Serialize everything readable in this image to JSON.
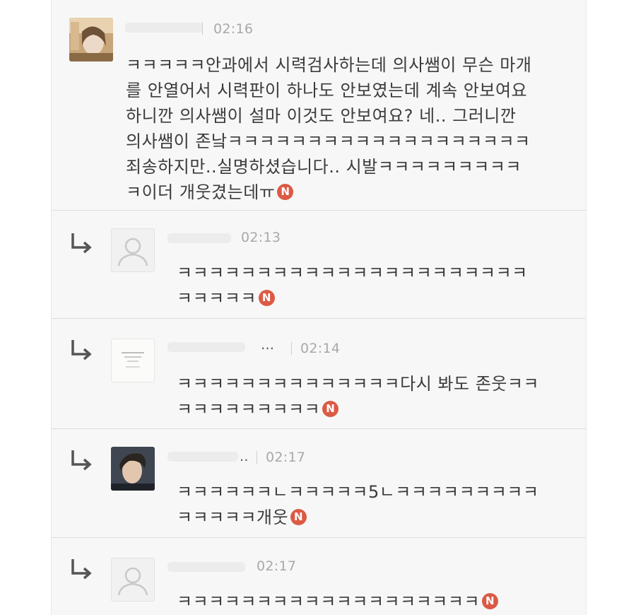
{
  "post": {
    "time": "02:16",
    "lines": [
      "ㅋㅋㅋㅋㅋ안과에서 시력검사하는데 의사쌤이 무슨 마개",
      "를 안열어서 시력판이 하나도 안보였는데 계속 안보여요",
      "하니깐 의사쌤이 설마 이것도 안보여요? 네.. 그러니깐",
      "의사쌤이 존낰ㅋㅋㅋㅋㅋㅋㅋㅋㅋㅋㅋㅋㅋㅋㅋㅋㅋㅋㅋ",
      "죄송하지만..실명하셨습니다.. 시발ㅋㅋㅋㅋㅋㅋㅋㅋㅋ",
      "ㅋ이더 개웃겼는데ㅠ"
    ],
    "badge": "N"
  },
  "replies": [
    {
      "time": "02:13",
      "lines": [
        "ㅋㅋㅋㅋㅋㅋㅋㅋㅋㅋㅋㅋㅋㅋㅋㅋㅋㅋㅋㅋㅋㅋ",
        "ㅋㅋㅋㅋㅋ"
      ],
      "badge": "N"
    },
    {
      "name_fragment": "…",
      "time": "02:14",
      "lines": [
        "ㅋㅋㅋㅋㅋㅋㅋㅋㅋㅋㅋㅋㅋㅋ다시 봐도 존웃ㅋㅋ",
        "ㅋㅋㅋㅋㅋㅋㅋㅋㅋ"
      ],
      "badge": "N"
    },
    {
      "name_fragment": "..",
      "time": "02:17",
      "lines": [
        "ㅋㅋㅋㅋㅋㅋㄴㅋㅋㅋㅋㅋ5ㄴㅋㅋㅋㅋㅋㅋㅋㅋㅋ",
        "ㅋㅋㅋㅋㅋ개웃"
      ],
      "badge": "N"
    },
    {
      "time": "02:17",
      "lines": [
        "ㅋㅋㅋㅋㅋㅋㅋㅋㅋㅋㅋㅋㅋㅋㅋㅋㅋㅋㅋ"
      ],
      "badge": "N"
    }
  ],
  "colors": {
    "badge": "#dc5a44",
    "time": "#a9a9a9",
    "text": "#3b3b3b",
    "panel": "#f7f7f7"
  },
  "icons": {
    "reply": "reply-arrow-icon",
    "default_avatar": "person-silhouette-icon"
  }
}
